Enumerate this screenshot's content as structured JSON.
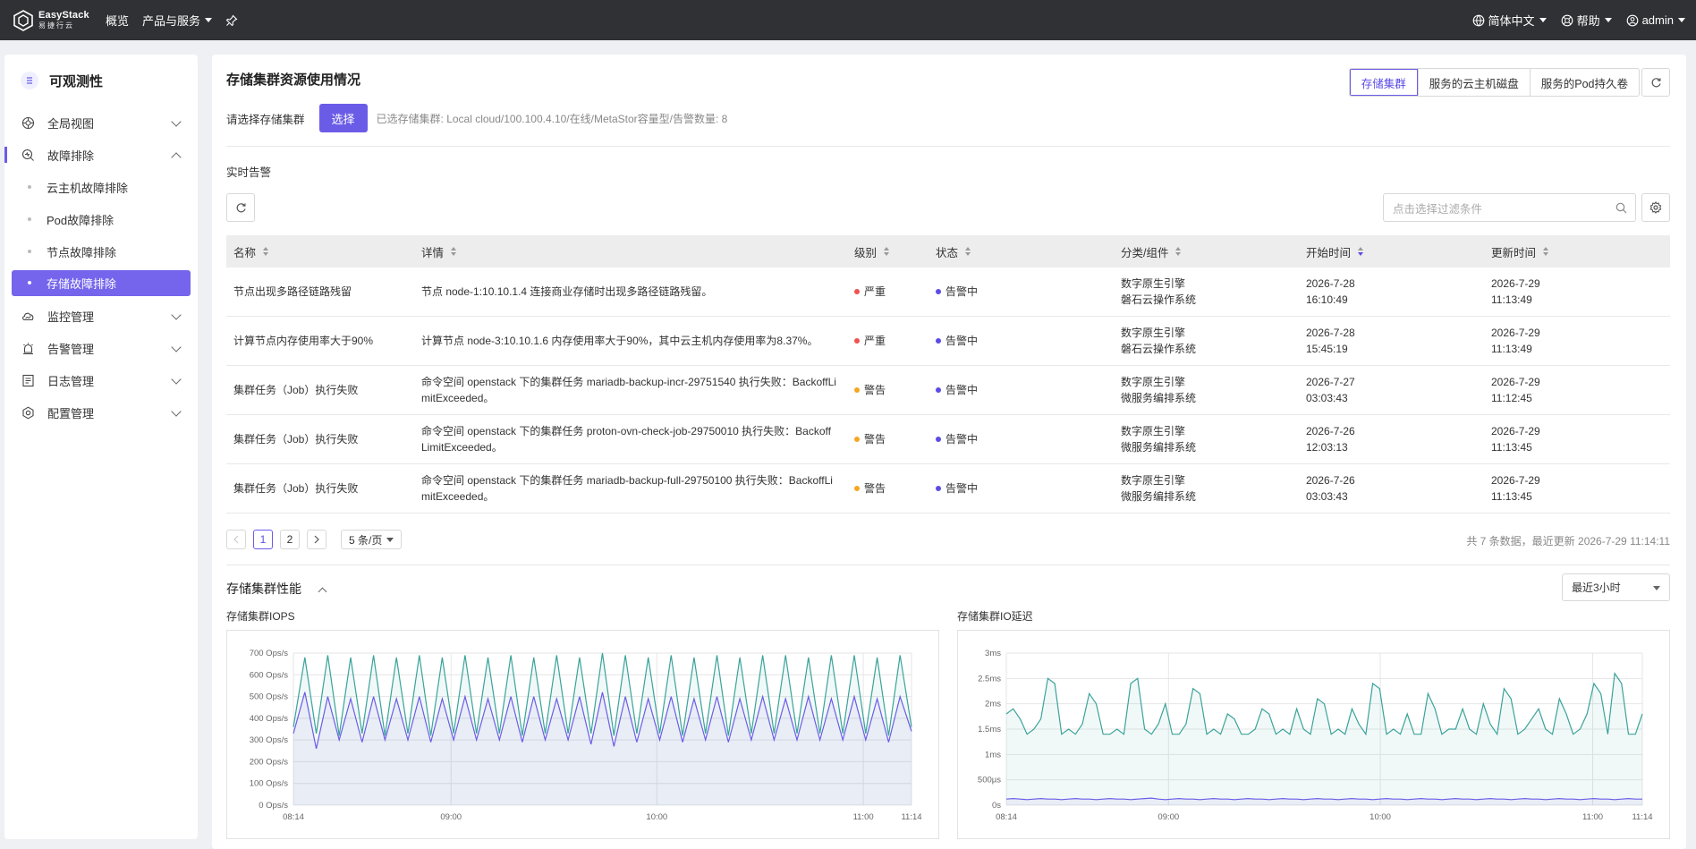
{
  "topbar": {
    "brand": "EasyStack",
    "brand_sub": "易捷行云",
    "nav": [
      "概览",
      "产品与服务"
    ],
    "language": "简体中文",
    "help": "帮助",
    "user": "admin"
  },
  "sidebar": {
    "title": "可观测性",
    "items": [
      {
        "label": "全局视图",
        "icon": "globe-icon"
      },
      {
        "label": "故障排除",
        "icon": "search-diagnose-icon"
      },
      {
        "label": "监控管理",
        "icon": "cloud-monitor-icon"
      },
      {
        "label": "告警管理",
        "icon": "alarm-icon"
      },
      {
        "label": "日志管理",
        "icon": "log-icon"
      },
      {
        "label": "配置管理",
        "icon": "settings-icon"
      }
    ],
    "subitems": [
      "云主机故障排除",
      "Pod故障排除",
      "节点故障排除",
      "存储故障排除"
    ]
  },
  "main": {
    "title": "存储集群资源使用情况",
    "tabs": [
      "存储集群",
      "服务的云主机磁盘",
      "服务的Pod持久卷"
    ],
    "select_label": "请选择存储集群",
    "select_button": "选择",
    "selected_info": "已选存储集群:  Local cloud/100.100.4.10/在线/MetaStor容量型/告警数量: 8",
    "realtime_label": "实时告警",
    "search_placeholder": "点击选择过滤条件"
  },
  "table": {
    "headers": [
      "名称",
      "详情",
      "级别",
      "状态",
      "分类/组件",
      "开始时间",
      "更新时间"
    ],
    "rows": [
      {
        "name": "节点出现多路径链路残留",
        "detail": "节点 node-1:10.10.1.4 连接商业存储时出现多路径链路残留。",
        "level": "严重",
        "status": "告警中",
        "cat1": "数字原生引擎",
        "cat2": "磐石云操作系统",
        "start_date": "2026-7-28",
        "start_time": "16:10:49",
        "upd_date": "2026-7-29",
        "upd_time": "11:13:49"
      },
      {
        "name": "计算节点内存使用率大于90%",
        "detail": "计算节点 node-3:10.10.1.6 内存使用率大于90%，其中云主机内存使用率为8.37%。",
        "level": "严重",
        "status": "告警中",
        "cat1": "数字原生引擎",
        "cat2": "磐石云操作系统",
        "start_date": "2026-7-28",
        "start_time": "15:45:19",
        "upd_date": "2026-7-29",
        "upd_time": "11:13:49"
      },
      {
        "name": "集群任务（Job）执行失败",
        "detail": "命令空间 openstack 下的集群任务 mariadb-backup-incr-29751540 执行失败：BackoffLimitExceeded。",
        "level": "警告",
        "status": "告警中",
        "cat1": "数字原生引擎",
        "cat2": "微服务编排系统",
        "start_date": "2026-7-27",
        "start_time": "03:03:43",
        "upd_date": "2026-7-29",
        "upd_time": "11:12:45"
      },
      {
        "name": "集群任务（Job）执行失败",
        "detail": "命令空间 openstack 下的集群任务 proton-ovn-check-job-29750010 执行失败：BackoffLimitExceeded。",
        "level": "警告",
        "status": "告警中",
        "cat1": "数字原生引擎",
        "cat2": "微服务编排系统",
        "start_date": "2026-7-26",
        "start_time": "12:03:13",
        "upd_date": "2026-7-29",
        "upd_time": "11:13:45"
      },
      {
        "name": "集群任务（Job）执行失败",
        "detail": "命令空间 openstack 下的集群任务 mariadb-backup-full-29750100 执行失败：BackoffLimitExceeded。",
        "level": "警告",
        "status": "告警中",
        "cat1": "数字原生引擎",
        "cat2": "微服务编排系统",
        "start_date": "2026-7-26",
        "start_time": "03:03:43",
        "upd_date": "2026-7-29",
        "upd_time": "11:13:45"
      }
    ]
  },
  "pagination": {
    "pages": [
      "1",
      "2"
    ],
    "page_size": "5 条/页",
    "info": "共 7 条数据，最近更新  2026-7-29 11:14:11"
  },
  "perf": {
    "title": "存储集群性能",
    "time_range": "最近3小时",
    "iops_title": "存储集群IOPS",
    "latency_title": "存储集群IO延迟"
  },
  "colors": {
    "accent": "#6b5ce7",
    "critical": "#f0524e",
    "warning": "#f5a623",
    "status": "#5b4ce6",
    "teal": "#3aa39a",
    "purple": "#6b5ce7"
  },
  "chart_data": [
    {
      "type": "line",
      "title": "存储集群IOPS",
      "x_ticks": [
        "08:14",
        "09:00",
        "10:00",
        "11:00",
        "11:14"
      ],
      "y_ticks": [
        "0 Ops/s",
        "100 Ops/s",
        "200 Ops/s",
        "300 Ops/s",
        "400 Ops/s",
        "500 Ops/s",
        "600 Ops/s",
        "700 Ops/s"
      ],
      "ylim": [
        0,
        700
      ],
      "series": [
        {
          "color": "#3aa39a",
          "values": [
            360,
            680,
            330,
            690,
            320,
            680,
            330,
            690,
            320,
            680,
            330,
            690,
            320,
            680,
            330,
            690,
            330,
            680,
            330,
            690,
            320,
            680,
            330,
            690,
            330,
            680,
            330,
            700,
            320,
            690,
            330,
            680,
            330,
            690,
            320,
            680,
            330,
            690,
            320,
            680,
            330,
            690,
            330,
            690,
            330,
            680,
            330,
            690,
            330,
            690,
            330,
            680,
            320,
            690,
            360
          ]
        },
        {
          "color": "#6b5ce7",
          "values": [
            330,
            520,
            260,
            500,
            300,
            490,
            290,
            500,
            300,
            490,
            300,
            500,
            290,
            490,
            300,
            500,
            300,
            490,
            300,
            500,
            290,
            500,
            300,
            490,
            300,
            500,
            280,
            520,
            270,
            500,
            290,
            490,
            300,
            500,
            290,
            490,
            300,
            500,
            290,
            490,
            300,
            500,
            300,
            490,
            300,
            500,
            300,
            490,
            300,
            500,
            300,
            490,
            290,
            500,
            340
          ]
        }
      ]
    },
    {
      "type": "line",
      "title": "存储集群IO延迟",
      "x_ticks": [
        "08:14",
        "09:00",
        "10:00",
        "11:00",
        "11:14"
      ],
      "y_ticks": [
        "0s",
        "500µs",
        "1ms",
        "1.5ms",
        "2ms",
        "2.5ms",
        "3ms"
      ],
      "ylim": [
        0,
        3
      ],
      "series": [
        {
          "color": "#3aa39a",
          "values": [
            1.8,
            1.9,
            1.7,
            1.4,
            1.5,
            1.7,
            2.5,
            2.4,
            1.4,
            1.5,
            1.4,
            1.6,
            2.2,
            2.0,
            1.4,
            1.4,
            1.5,
            1.4,
            2.4,
            2.5,
            1.5,
            1.4,
            1.6,
            2.0,
            1.4,
            1.4,
            1.6,
            2.3,
            2.2,
            1.4,
            1.5,
            1.4,
            1.8,
            1.7,
            1.4,
            1.4,
            1.5,
            1.9,
            1.8,
            1.4,
            1.5,
            1.4,
            1.9,
            1.5,
            1.4,
            2.1,
            2.0,
            1.4,
            1.5,
            1.4,
            1.9,
            1.6,
            1.4,
            2.4,
            2.3,
            1.4,
            1.5,
            1.4,
            1.8,
            1.4,
            1.4,
            2.2,
            1.9,
            1.4,
            1.5,
            1.5,
            1.9,
            1.5,
            1.4,
            2.0,
            1.6,
            1.4,
            2.3,
            2.1,
            1.4,
            1.5,
            1.7,
            1.9,
            1.5,
            1.4,
            2.1,
            1.8,
            1.4,
            1.5,
            1.8,
            2.4,
            2.2,
            1.4,
            2.6,
            2.4,
            1.4,
            1.4,
            1.8
          ]
        },
        {
          "color": "#6b5ce7",
          "values": [
            0.12,
            0.13,
            0.12,
            0.11,
            0.12,
            0.13,
            0.12,
            0.12,
            0.11,
            0.12,
            0.13,
            0.12,
            0.12,
            0.11,
            0.12,
            0.13,
            0.12,
            0.12,
            0.11,
            0.12,
            0.13,
            0.14,
            0.12,
            0.11,
            0.12,
            0.13,
            0.12,
            0.12,
            0.11,
            0.12,
            0.13,
            0.12,
            0.12,
            0.11,
            0.12,
            0.13,
            0.12,
            0.12,
            0.11,
            0.12,
            0.13,
            0.12,
            0.12,
            0.11,
            0.12,
            0.13,
            0.12,
            0.12,
            0.11,
            0.12,
            0.13,
            0.12,
            0.12,
            0.11,
            0.12,
            0.13,
            0.12,
            0.12,
            0.11,
            0.12,
            0.13,
            0.12,
            0.12,
            0.11,
            0.12,
            0.13,
            0.12,
            0.12,
            0.11,
            0.12,
            0.13,
            0.12,
            0.12,
            0.11,
            0.12,
            0.13,
            0.12,
            0.12,
            0.11,
            0.12,
            0.13,
            0.12,
            0.12,
            0.11,
            0.12,
            0.13,
            0.12,
            0.12,
            0.11,
            0.12,
            0.13,
            0.12,
            0.12
          ]
        }
      ]
    }
  ]
}
